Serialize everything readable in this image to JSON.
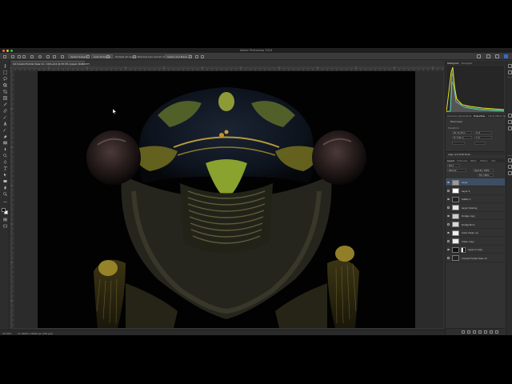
{
  "app": {
    "window_title": "Adobe Photoshop 2024"
  },
  "options_bar": {
    "select_subject": "Select Subject",
    "auto_enhance": "Auto-Enhance",
    "sample_all_layers": "Sample All Layers",
    "remove_hair": "Remove hair and all mask selections",
    "select_and_mask": "Select and Mask..."
  },
  "document": {
    "tab_title": "19 Cicada Frontal View 11 - 100 µm1 @ 33.3% (Layer, RGB/16*)"
  },
  "status_bar": {
    "zoom": "33.33%",
    "dimensions": "11 Width x 8000 px (150 ppi)"
  },
  "panels": {
    "top_tabs": [
      "Histogram",
      "Navigator"
    ],
    "props_tabs": [
      "Libraries",
      "Adjustments",
      "Properties",
      "Info & Other Tips"
    ],
    "props_active": "Properties",
    "pixel_layer": "Pixel Layer",
    "transform": "Transform",
    "w": "W: 11.25 in",
    "h": "H: 7.81 in",
    "x": "X: 0",
    "y": "Y: 0",
    "align": "Align and Distribute",
    "layer_tabs": [
      "Layers",
      "Channels",
      "Paths",
      "History",
      "Info"
    ],
    "layers_active": "Layers",
    "kind": "Kind",
    "blend_mode": "Normal",
    "opacity": "Opacity: 100%",
    "fill": "Fill: 100%",
    "layers": [
      {
        "name": "Layer",
        "selected": true,
        "thumb": "#9a9a9a",
        "mask": false
      },
      {
        "name": "Layer 2",
        "selected": false,
        "thumb": "#ffffff",
        "mask": false
      },
      {
        "name": "Soften 1",
        "selected": false,
        "thumb": "#222222",
        "mask": false
      },
      {
        "name": "Layer Overlay",
        "selected": false,
        "thumb": "#e6e6e6",
        "mask": false
      },
      {
        "name": "Dodge copy",
        "selected": false,
        "thumb": "#cfcfcf",
        "mask": false
      },
      {
        "name": "Dodge Burn",
        "selected": false,
        "thumb": "#d8d8d8",
        "mask": false
      },
      {
        "name": "Color Clean up",
        "selected": false,
        "thumb": "#f0f0f0",
        "mask": false
      },
      {
        "name": "Clean copy",
        "selected": false,
        "thumb": "#ededed",
        "mask": false
      },
      {
        "name": "Layer 0 copy",
        "selected": false,
        "thumb": "#111111",
        "mask": true
      },
      {
        "name": "Cicada Frontal View 11",
        "selected": false,
        "thumb": "#222222",
        "mask": false
      }
    ]
  },
  "colors": {
    "accent": "#2f6dd6",
    "layer_selected": "#3d4d63",
    "hist_yellow": "#e4df1d",
    "hist_green": "#4fc24a",
    "hist_cyan": "#5fd0d8"
  }
}
